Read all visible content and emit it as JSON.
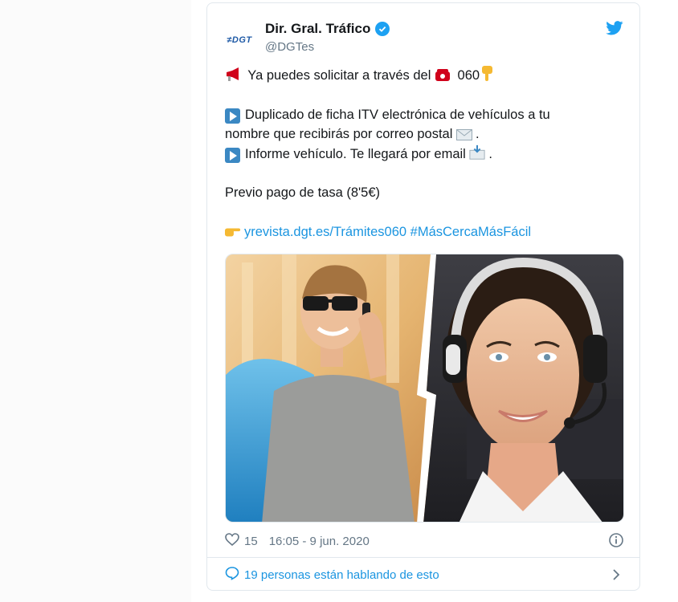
{
  "tweet": {
    "author_name": "Dir. Gral. Tráfico",
    "handle": "@DGTes",
    "avatar_text": "≠DGT",
    "lines": {
      "l1_text": " Ya puedes solicitar a través del ",
      "l1_number": " 060",
      "l2": "Duplicado de ficha ITV electrónica de vehículos a tu",
      "l3": "nombre que recibirás por correo postal ",
      "l3_end": ".",
      "l4": "Informe vehículo. Te llegará por email ",
      "l4_end": ".",
      "l5": "Previo pago de tasa (8'5€)",
      "link_url": "yrevista.dgt.es/Trámites060",
      "hashtag": "#MásCercaMásFácil"
    },
    "likes": "15",
    "timestamp": "16:05 - 9 jun. 2020",
    "conversation": "19 personas están hablando de esto"
  },
  "colors": {
    "link": "#1b95e0",
    "verified": "#1da1f2",
    "secondary_text": "#657786",
    "border": "#e1e8ed"
  },
  "icons": [
    "megaphone-icon",
    "telephone-icon",
    "point-down-icon",
    "play-button-icon",
    "envelope-icon",
    "envelope-arrow-icon",
    "point-right-icon",
    "heart-icon",
    "info-icon",
    "speech-bubble-icon",
    "chevron-right-icon",
    "twitter-bird-icon",
    "verified-badge-icon"
  ]
}
